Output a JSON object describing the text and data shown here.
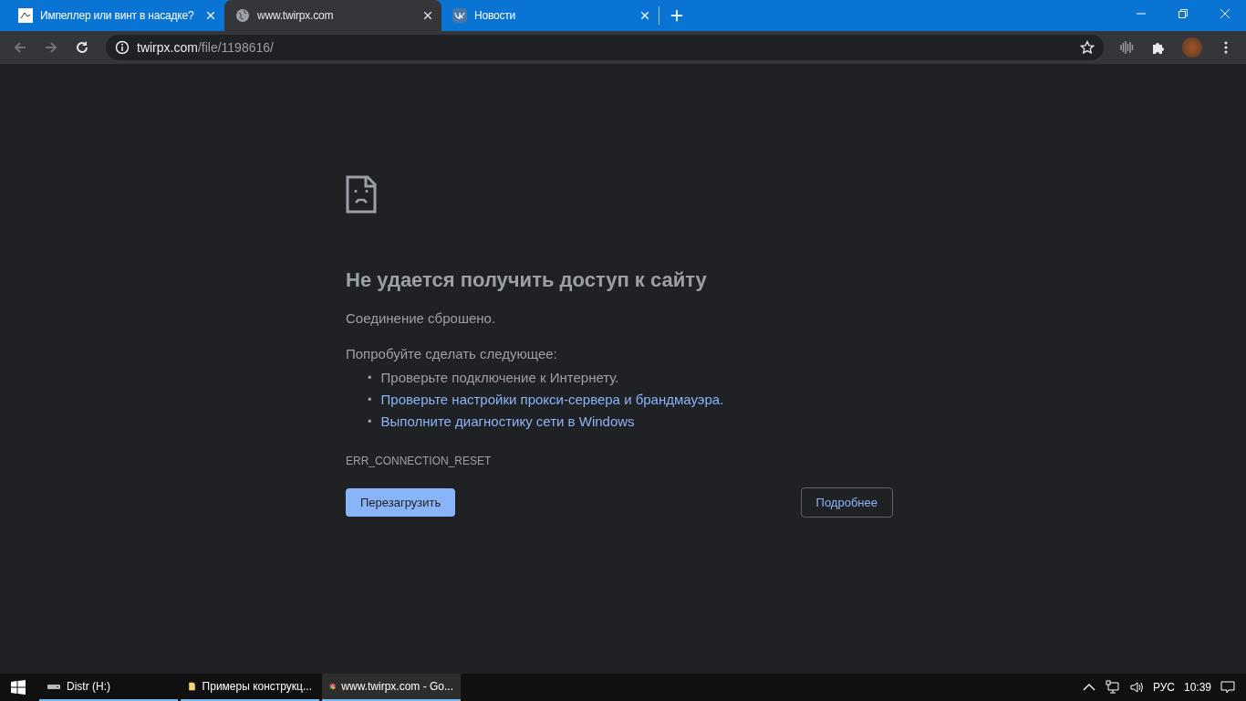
{
  "tabs": [
    {
      "title": "Импеллер или винт в насадке?",
      "selected": false
    },
    {
      "title": "www.twirpx.com",
      "selected": true
    },
    {
      "title": "Новости",
      "selected": false
    }
  ],
  "address": {
    "host": "twirpx.com",
    "path": "/file/1198616/"
  },
  "error": {
    "title": "Не удается получить доступ к сайту",
    "message": "Соединение сброшено.",
    "suggest_heading": "Попробуйте сделать следующее:",
    "suggestions": [
      {
        "bullet": "•",
        "text": "Проверьте подключение к Интернету.",
        "kind": "text"
      },
      {
        "bullet": "•",
        "text": "Проверьте настройки прокси-сервера и брандмауэра.",
        "kind": "link"
      },
      {
        "bullet": "•",
        "text": "Выполните диагностику сети в Windows",
        "kind": "link"
      }
    ],
    "code": "ERR_CONNECTION_RESET",
    "reload_button": "Перезагрузить",
    "details_button": "Подробнее"
  },
  "taskbar": {
    "apps": [
      {
        "label": "Distr (H:)",
        "selected": false
      },
      {
        "label": "Примеры конструкц...",
        "selected": false
      },
      {
        "label": "www.twirpx.com - Go...",
        "selected": true
      }
    ],
    "language": "РУС",
    "time": "10:39"
  }
}
